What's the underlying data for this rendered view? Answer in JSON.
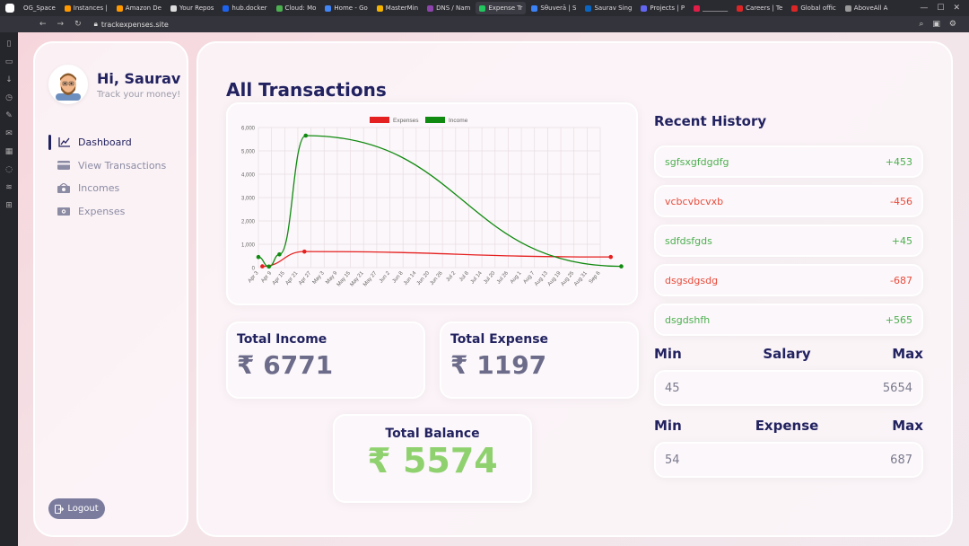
{
  "browser": {
    "profile_tab": "OG_Space",
    "tabs": [
      {
        "label": "Instances |",
        "color": "#f90"
      },
      {
        "label": "Amazon De",
        "color": "#f90"
      },
      {
        "label": "Your Repos",
        "color": "#ddd"
      },
      {
        "label": "hub.docker",
        "color": "#1d63ed"
      },
      {
        "label": "Cloud: Mo",
        "color": "#4caf50"
      },
      {
        "label": "Home - Go",
        "color": "#4285f4"
      },
      {
        "label": "MasterMin",
        "color": "#f4b400"
      },
      {
        "label": "DNS / Nam",
        "color": "#8e44ad"
      },
      {
        "label": "Expense Tr",
        "color": "#22c55e"
      },
      {
        "label": "Sθuverā | S",
        "color": "#3b82f6"
      },
      {
        "label": "Saurav Sing",
        "color": "#0a66c2"
      },
      {
        "label": "Projects | P",
        "color": "#6366f1"
      },
      {
        "label": "________",
        "color": "#e11d48"
      },
      {
        "label": "Careers | Te",
        "color": "#dc2626"
      },
      {
        "label": "Global offic",
        "color": "#dc2626"
      },
      {
        "label": "AboveAll A",
        "color": "#999"
      }
    ],
    "url": "trackexpenses.site"
  },
  "user": {
    "greeting": "Hi, Saurav",
    "subtitle": "Track your money!"
  },
  "menu": [
    {
      "label": "Dashboard",
      "icon": "chart-line-icon",
      "active": true
    },
    {
      "label": "View Transactions",
      "icon": "credit-card-icon",
      "active": false
    },
    {
      "label": "Incomes",
      "icon": "money-bill-icon",
      "active": false
    },
    {
      "label": "Expenses",
      "icon": "money-receipt-icon",
      "active": false
    }
  ],
  "logout_label": "Logout",
  "page_title": "All Transactions",
  "chart_data": {
    "type": "line",
    "legend": [
      "Expenses",
      "Income"
    ],
    "legend_placement": "top-center",
    "categories": [
      "Apr 3",
      "Apr 9",
      "Apr 15",
      "Apr 21",
      "Apr 27",
      "May 3",
      "May 9",
      "May 15",
      "May 21",
      "May 27",
      "Jun 2",
      "Jun 8",
      "Jun 14",
      "Jun 20",
      "Jun 26",
      "Jul 2",
      "Jul 8",
      "Jul 14",
      "Jul 20",
      "Jul 26",
      "Aug 1",
      "Aug 7",
      "Aug 13",
      "Aug 19",
      "Aug 25",
      "Aug 31",
      "Sep 6"
    ],
    "ylim": [
      0,
      6000
    ],
    "yticks": [
      "0",
      "1,000",
      "2,000",
      "3,000",
      "4,000",
      "5,000",
      "6,000"
    ],
    "grid": true,
    "series": [
      {
        "name": "Expenses",
        "color": "#e52020",
        "points": [
          [
            0.3,
            54
          ],
          [
            3.5,
            687
          ],
          [
            26.8,
            456
          ]
        ]
      },
      {
        "name": "Income",
        "color": "#108a10",
        "points": [
          [
            0,
            453
          ],
          [
            0.8,
            45
          ],
          [
            1.6,
            565
          ],
          [
            3.6,
            5654
          ],
          [
            27.6,
            54
          ]
        ]
      }
    ]
  },
  "totals": {
    "income_label": "Total Income",
    "income_value": "₹ 6771",
    "expense_label": "Total Expense",
    "expense_value": "₹ 1197",
    "balance_label": "Total Balance",
    "balance_value": "₹ 5574"
  },
  "recent_history": {
    "title": "Recent History",
    "items": [
      {
        "title": "sgfsxgfdgdfg",
        "amount": "+453",
        "type": "income"
      },
      {
        "title": "vcbcvbcvxb",
        "amount": "-456",
        "type": "expense"
      },
      {
        "title": "sdfdsfgds",
        "amount": "+45",
        "type": "income"
      },
      {
        "title": "dsgsdgsdg",
        "amount": "-687",
        "type": "expense"
      },
      {
        "title": "dsgdshfh",
        "amount": "+565",
        "type": "income"
      }
    ]
  },
  "salary_range": {
    "min_label": "Min",
    "title": "Salary",
    "max_label": "Max",
    "min": "45",
    "max": "5654"
  },
  "expense_range": {
    "min_label": "Min",
    "title": "Expense",
    "max_label": "Max",
    "min": "54",
    "max": "687"
  }
}
